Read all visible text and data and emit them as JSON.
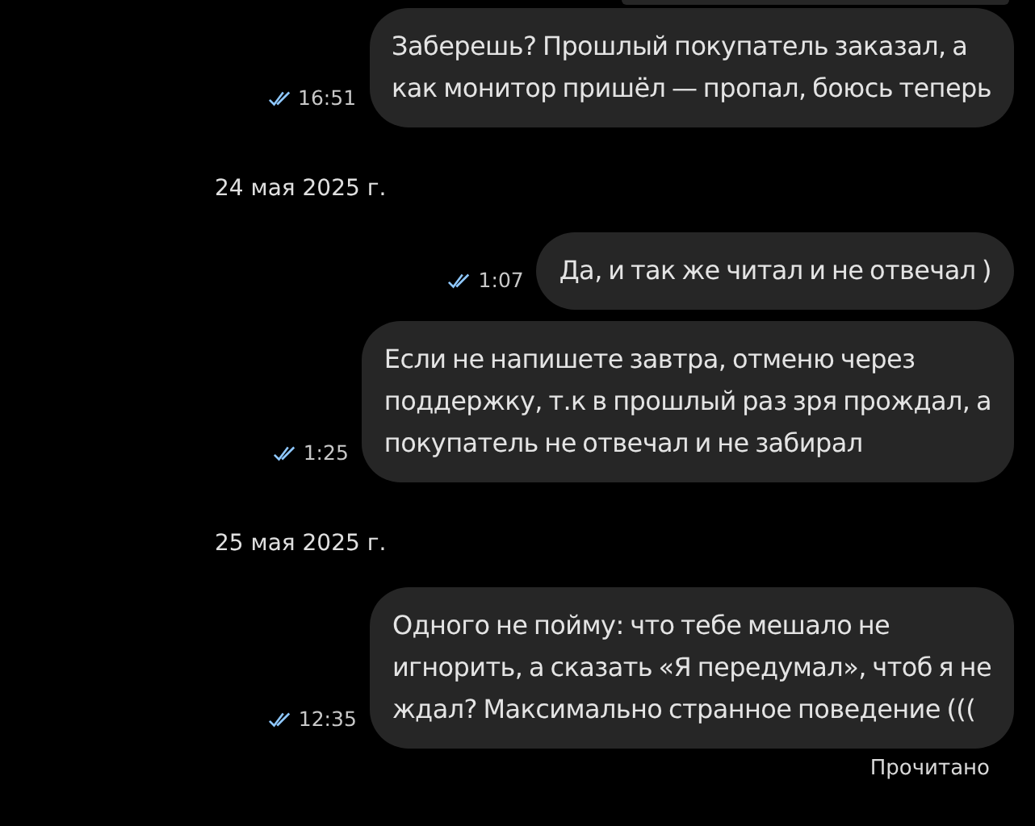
{
  "messages": [
    {
      "kind": "message",
      "text": "Заберешь? Прошлый покупатель заказал, а\nкак монитор пришёл — пропал, боюсь теперь",
      "time": "16:51",
      "read": true
    },
    {
      "kind": "date",
      "text": "24 мая 2025 г."
    },
    {
      "kind": "message",
      "text": "Да, и так же читал и не отвечал )",
      "time": "1:07",
      "read": true
    },
    {
      "kind": "message",
      "text": "Если не напишете завтра, отменю через\nподдержку, т.к в прошлый раз зря прождал, а\nпокупатель не отвечал и не забирал",
      "time": "1:25",
      "read": true
    },
    {
      "kind": "date",
      "text": "25 мая 2025 г."
    },
    {
      "kind": "message",
      "text": "Одного не пойму: что тебе мешало не\nигнорить, а сказать «Я передумал», чтоб я не\nждал? Максимально странное поведение (((",
      "time": "12:35",
      "read": true
    }
  ],
  "read_status": "Прочитано"
}
